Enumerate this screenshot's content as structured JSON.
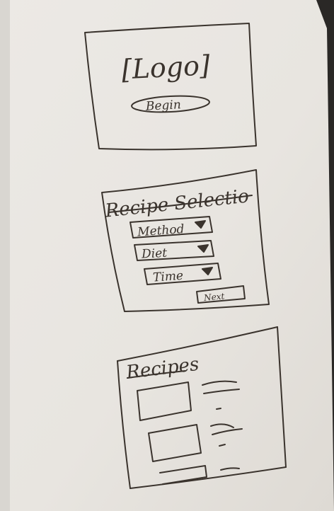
{
  "frames": {
    "splash": {
      "logo_text": "[Logo]",
      "begin_label": "Begin"
    },
    "selection": {
      "title": "Recipe Selectio",
      "dropdowns": [
        {
          "label": "Method"
        },
        {
          "label": "Diet"
        },
        {
          "label": "Time"
        }
      ],
      "next_label": "Next"
    },
    "recipes": {
      "title": "Recipes"
    }
  },
  "colors": {
    "ink": "#3a332d",
    "paper": "#e9e6e1",
    "background": "#2a2826"
  }
}
